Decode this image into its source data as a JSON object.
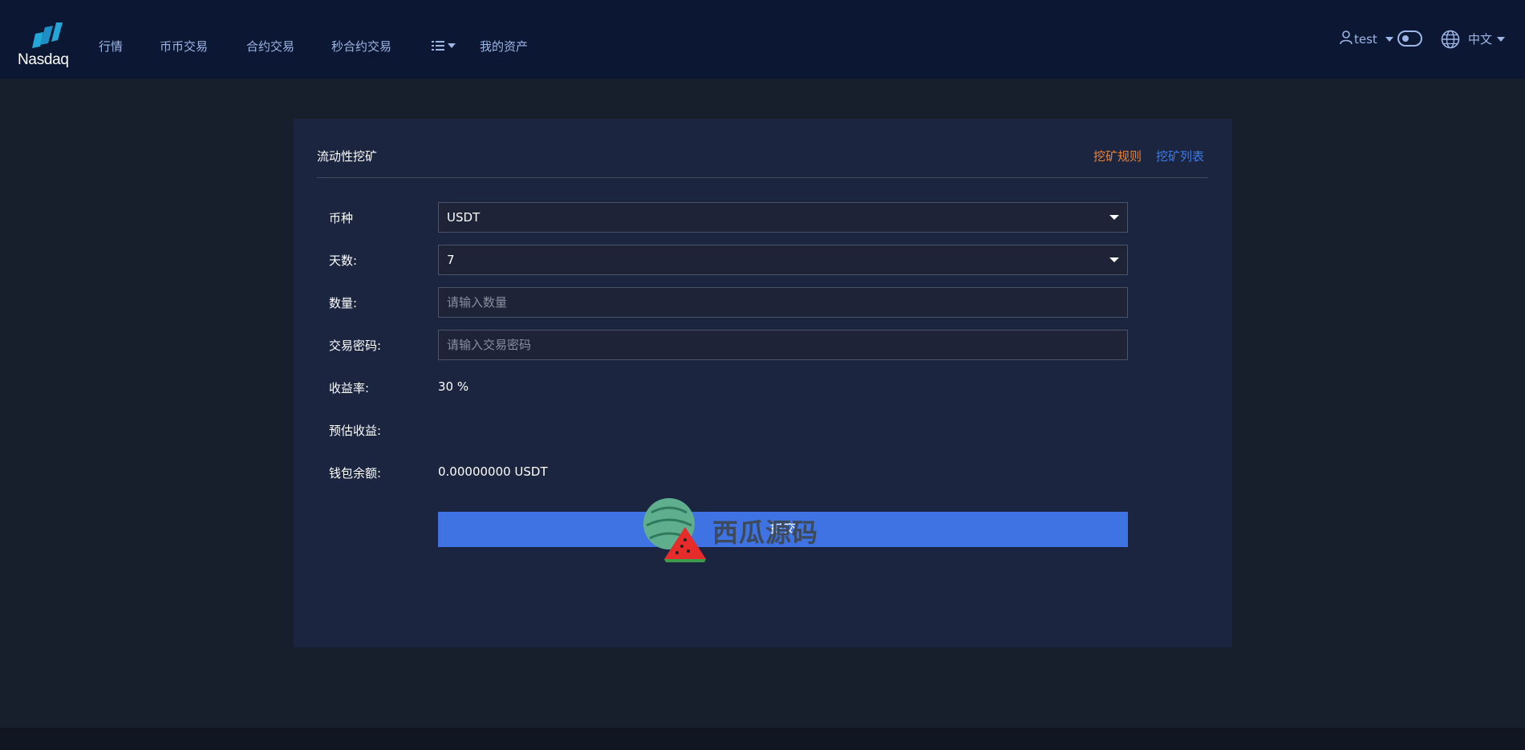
{
  "header": {
    "logo_text": "Nasdaq",
    "nav": [
      {
        "label": "行情"
      },
      {
        "label": "币币交易"
      },
      {
        "label": "合约交易"
      },
      {
        "label": "秒合约交易"
      },
      {
        "label": "我的资产"
      }
    ],
    "menu_icon": "list-icon",
    "user": {
      "name": "test",
      "icon": "user-icon"
    },
    "theme_toggle": {
      "state": "off"
    },
    "language": {
      "label": "中文",
      "icon": "globe-icon"
    }
  },
  "card": {
    "title": "流动性挖矿",
    "links": {
      "rules": "挖矿规则",
      "list": "挖矿列表"
    },
    "form": {
      "currency": {
        "label": "币种",
        "value": "USDT"
      },
      "days": {
        "label": "天数:",
        "value": "7"
      },
      "amount": {
        "label": "数量:",
        "placeholder": "请输入数量",
        "value": ""
      },
      "trade_password": {
        "label": "交易密码:",
        "placeholder": "请输入交易密码",
        "value": ""
      },
      "yield_rate": {
        "label": "收益率:",
        "value": "30 %"
      },
      "estimated_income": {
        "label": "预估收益:",
        "value": ""
      },
      "wallet_balance": {
        "label": "钱包余额:",
        "value": "0.00000000 USDT"
      }
    },
    "submit_label": "提交"
  },
  "watermark": {
    "text": "西瓜源码",
    "icon": "watermelon-icon"
  },
  "colors": {
    "header_bg": "#0c1733",
    "page_bg": "#171e2c",
    "card_bg": "#1b2540",
    "nav_text": "#9cb6e6",
    "accent_orange": "#e8833a",
    "accent_blue": "#3f7ae5",
    "button_blue": "#3f73e3"
  }
}
